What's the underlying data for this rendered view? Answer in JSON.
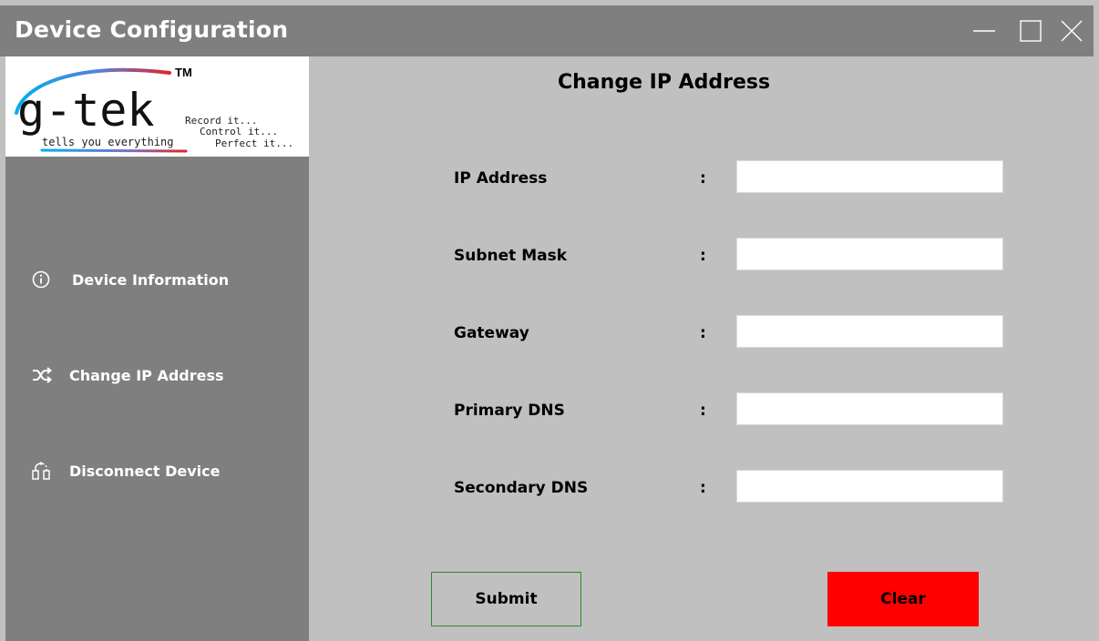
{
  "window": {
    "title": "Device Configuration",
    "controls": [
      "minimize-icon",
      "maximize-icon",
      "close-icon"
    ]
  },
  "logo": {
    "brand": "g-tek",
    "trademark": "TM",
    "tagline": "tells you everything",
    "slogans": [
      "Record it...",
      "Control it...",
      "Perfect it..."
    ]
  },
  "sidebar": {
    "items": [
      {
        "label": "Device Information",
        "icon": "info-icon"
      },
      {
        "label": "Change IP Address",
        "icon": "shuffle-icon"
      },
      {
        "label": "Disconnect Device",
        "icon": "disconnect-icon"
      }
    ]
  },
  "main": {
    "heading": "Change IP Address",
    "fields": [
      {
        "label": "IP Address",
        "colon": ":",
        "value": ""
      },
      {
        "label": "Subnet Mask",
        "colon": ":",
        "value": ""
      },
      {
        "label": "Gateway",
        "colon": ":",
        "value": ""
      },
      {
        "label": "Primary DNS",
        "colon": ":",
        "value": ""
      },
      {
        "label": "Secondary DNS",
        "colon": ":",
        "value": ""
      }
    ],
    "submit_label": "Submit",
    "clear_label": "Clear"
  },
  "colors": {
    "titlebar": "#7f7f7f",
    "sidebar": "#7f7f7f",
    "panel": "#c0c0c0",
    "clear_button": "#ff0000",
    "submit_border": "#2e8b2e"
  }
}
